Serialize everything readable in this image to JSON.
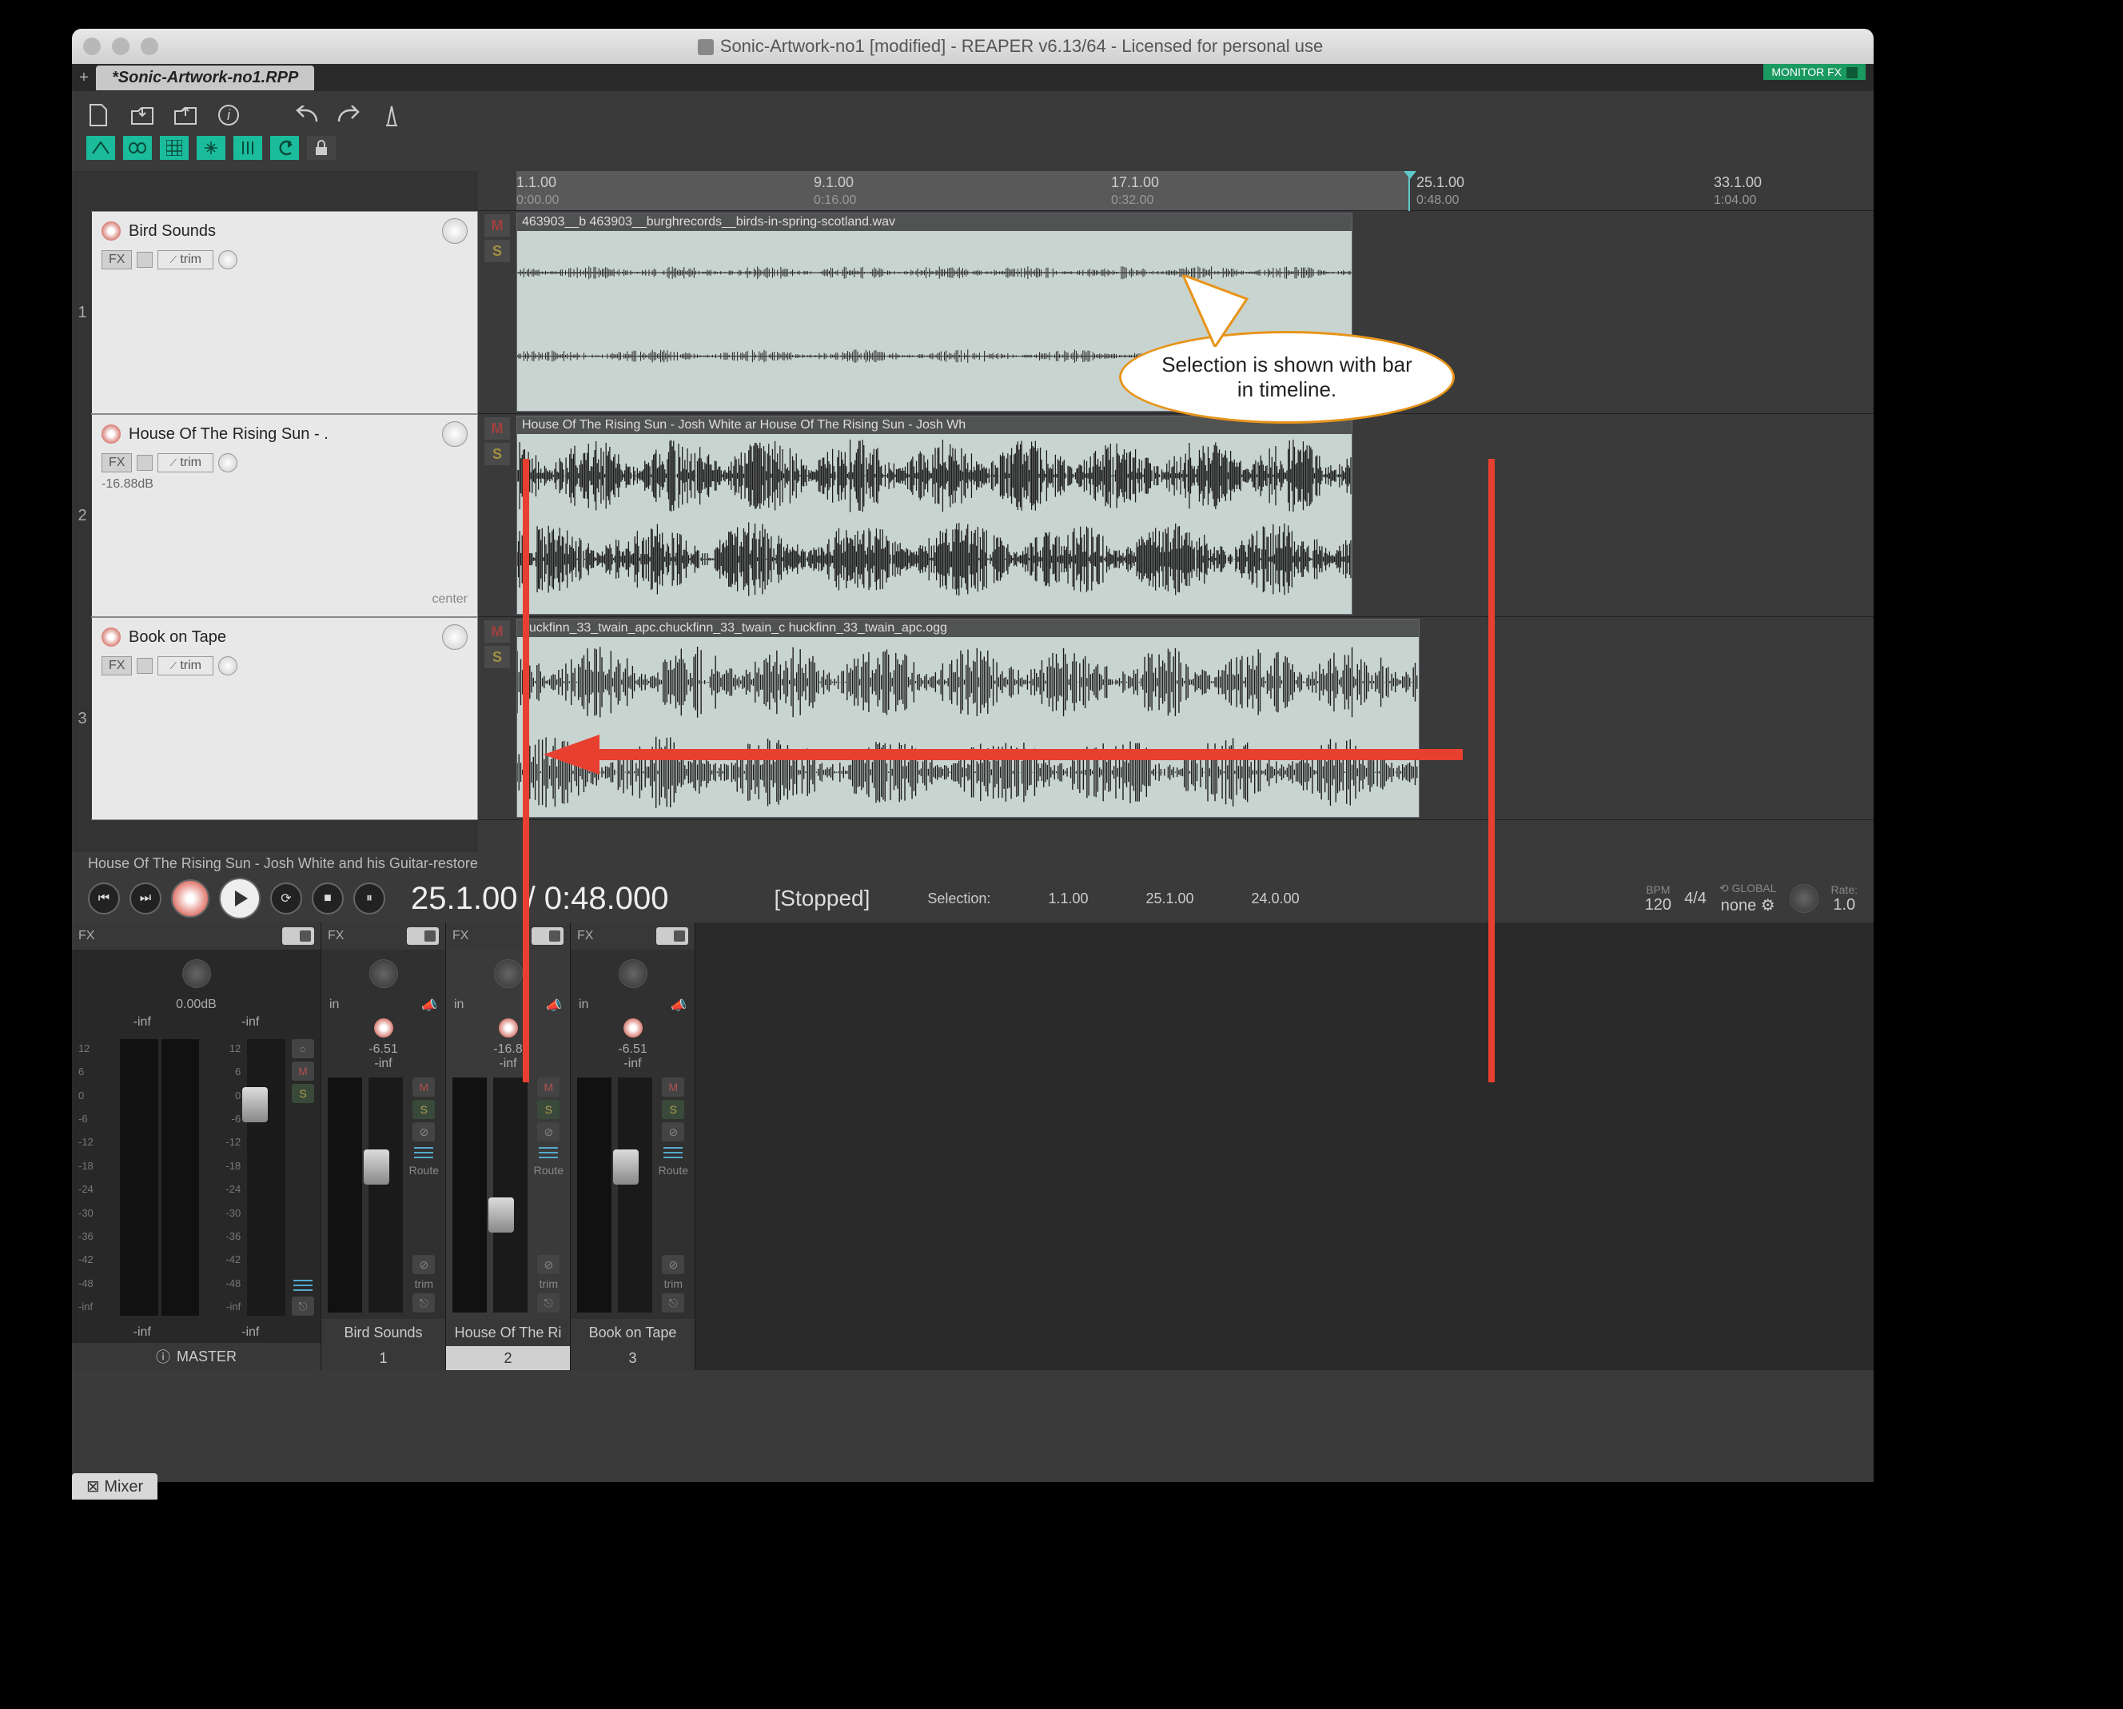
{
  "window": {
    "title": "Sonic-Artwork-no1 [modified] - REAPER v6.13/64 - Licensed for personal use",
    "project_tab": "*Sonic-Artwork-no1.RPP",
    "monitor_fx": "MONITOR FX"
  },
  "ruler": {
    "marks": [
      {
        "bar": "1.1.00",
        "time": "0:00.00"
      },
      {
        "bar": "9.1.00",
        "time": "0:16.00"
      },
      {
        "bar": "17.1.00",
        "time": "0:32.00"
      },
      {
        "bar": "25.1.00",
        "time": "0:48.00"
      },
      {
        "bar": "33.1.00",
        "time": "1:04.00"
      }
    ]
  },
  "tracks": [
    {
      "name": "Bird Sounds",
      "db": "",
      "center": "",
      "clip": "463903__b 463903__burghrecords__birds-in-spring-scotland.wav"
    },
    {
      "name": "House Of The Rising Sun - .",
      "db": "-16.88dB",
      "center": "center",
      "clip": "House Of The Rising Sun - Josh White ar House Of The Rising Sun - Josh Wh"
    },
    {
      "name": "Book on Tape",
      "db": "",
      "center": "",
      "clip": "huckfinn_33_twain_apc.chuckfinn_33_twain_c huckfinn_33_twain_apc.ogg"
    }
  ],
  "fx_label": "FX",
  "trim_label": "trim",
  "status_line": "House Of The Rising Sun - Josh White and his Guitar-restore",
  "transport": {
    "timecode": "25.1.00 / 0:48.000",
    "state": "[Stopped]",
    "selection_label": "Selection:",
    "sel_start": "1.1.00",
    "sel_end": "25.1.00",
    "sel_len": "24.0.00",
    "bpm_label": "BPM",
    "bpm": "120",
    "sig": "4/4",
    "global_label": "GLOBAL",
    "global": "none",
    "rate_label": "Rate:",
    "rate": "1.0"
  },
  "mixer": {
    "master": {
      "name": "MASTER",
      "db": "0.00dB",
      "inf": "-inf",
      "scale": [
        "12",
        "6",
        "0",
        "-6",
        "-12",
        "-18",
        "-24",
        "-30",
        "-36",
        "-42",
        "-48",
        "-inf"
      ]
    },
    "channels": [
      {
        "name": "Bird Sounds",
        "num": "1",
        "db": "-6.51",
        "in": "in",
        "inf": "-inf",
        "route": "Route",
        "trim": "trim"
      },
      {
        "name": "House Of The Ri",
        "num": "2",
        "db": "-16.8",
        "in": "in",
        "inf": "-inf",
        "route": "Route",
        "trim": "trim"
      },
      {
        "name": "Book on Tape",
        "num": "3",
        "db": "-6.51",
        "in": "in",
        "inf": "-inf",
        "route": "Route",
        "trim": "trim"
      }
    ],
    "fx": "FX",
    "tab": "Mixer"
  },
  "callout": "Selection is shown with bar in timeline.",
  "icons": {
    "m": "M",
    "s": "S"
  }
}
